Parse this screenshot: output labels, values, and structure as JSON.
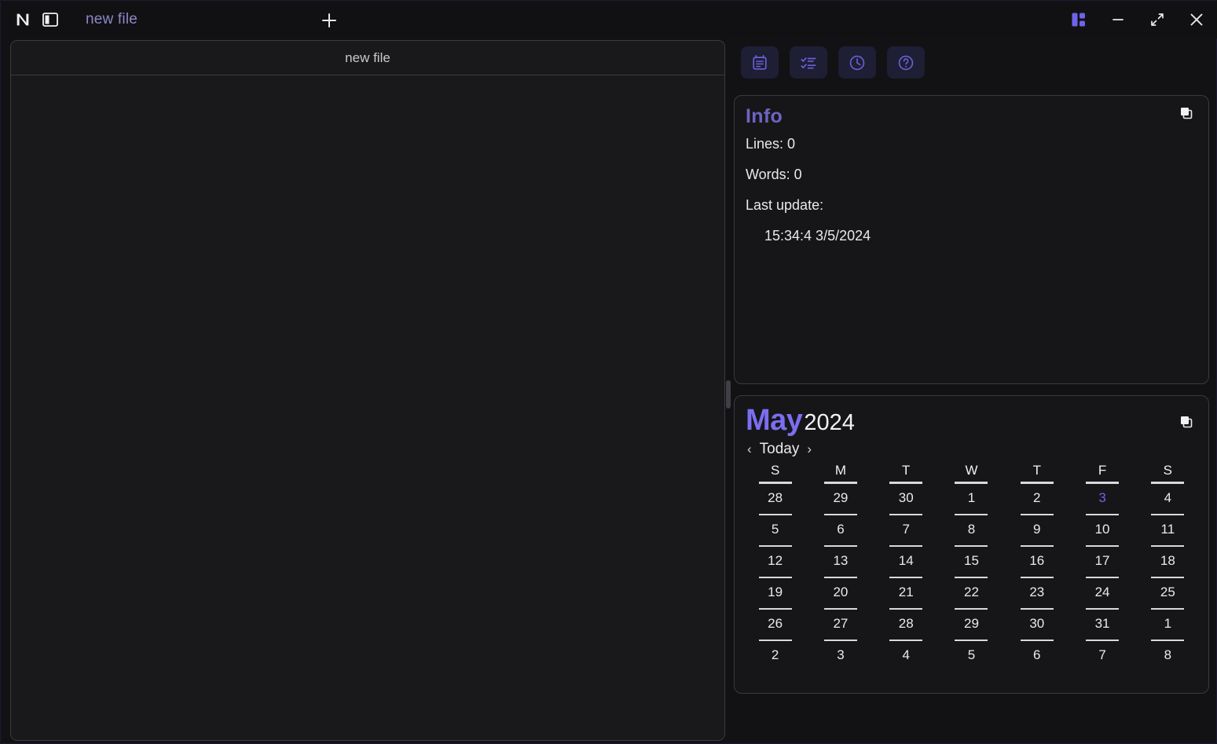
{
  "titlebar": {
    "logo": "N",
    "logo_icon": "app-logo-n",
    "panel_toggle_icon": "sidebar-toggle-icon",
    "tab_label": "new file",
    "new_tab_icon": "plus-icon",
    "window_controls": [
      {
        "name": "layout-toggle",
        "icon": "layout-grid-icon",
        "glyph": ""
      },
      {
        "name": "minimize",
        "icon": "minimize-icon",
        "glyph": "—"
      },
      {
        "name": "maximize",
        "icon": "maximize-icon",
        "glyph": "⤢"
      },
      {
        "name": "close",
        "icon": "close-icon",
        "glyph": "✕"
      }
    ]
  },
  "editor": {
    "header_title": "new file",
    "content": "",
    "placeholder": ""
  },
  "toolbar": {
    "buttons": [
      {
        "name": "notes-button",
        "icon": "notes-icon",
        "label": "Notes"
      },
      {
        "name": "checklist-button",
        "icon": "checklist-icon",
        "label": "Checklist"
      },
      {
        "name": "clock-button",
        "icon": "clock-icon",
        "label": "Clock"
      },
      {
        "name": "help-button",
        "icon": "help-icon",
        "label": "Help"
      }
    ]
  },
  "info": {
    "title": "Info",
    "copy_icon": "copy-icon",
    "lines_label": "Lines: 0",
    "words_label": "Words: 0",
    "last_update_label": "Last update:",
    "last_update_value": "15:34:4  3/5/2024"
  },
  "calendar": {
    "month": "May",
    "year": "2024",
    "copy_icon": "copy-icon",
    "prev_label": "‹",
    "today_label": "Today",
    "next_label": "›",
    "day_headers": [
      "S",
      "M",
      "T",
      "W",
      "T",
      "F",
      "S"
    ],
    "today_date": "3",
    "weeks": [
      [
        "28",
        "29",
        "30",
        "1",
        "2",
        "3",
        "4"
      ],
      [
        "5",
        "6",
        "7",
        "8",
        "9",
        "10",
        "11"
      ],
      [
        "12",
        "13",
        "14",
        "15",
        "16",
        "17",
        "18"
      ],
      [
        "19",
        "20",
        "21",
        "22",
        "23",
        "24",
        "25"
      ],
      [
        "26",
        "27",
        "28",
        "29",
        "30",
        "31",
        "1"
      ],
      [
        "2",
        "3",
        "4",
        "5",
        "6",
        "7",
        "8"
      ]
    ]
  },
  "colors": {
    "accent_purple": "#6f63e8",
    "accent_purple_dim": "#6f63c4",
    "month_purple": "#7b6ef0",
    "tab_purple": "#8d87c8",
    "bg_window": "#121214",
    "bg_card": "#161618",
    "bg_editor": "#19191b",
    "border": "#3a3a3e",
    "text": "#eaeaee"
  }
}
